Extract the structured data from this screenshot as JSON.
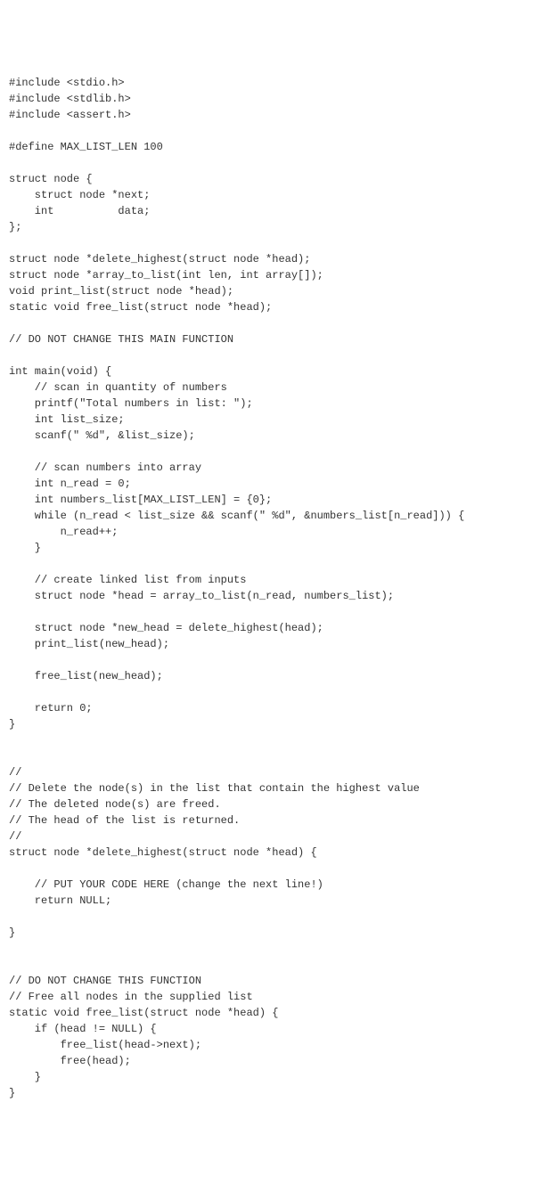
{
  "code": {
    "lines": [
      "#include <stdio.h>",
      "#include <stdlib.h>",
      "#include <assert.h>",
      "",
      "#define MAX_LIST_LEN 100",
      "",
      "struct node {",
      "    struct node *next;",
      "    int          data;",
      "};",
      "",
      "struct node *delete_highest(struct node *head);",
      "struct node *array_to_list(int len, int array[]);",
      "void print_list(struct node *head);",
      "static void free_list(struct node *head);",
      "",
      "// DO NOT CHANGE THIS MAIN FUNCTION",
      "",
      "int main(void) {",
      "    // scan in quantity of numbers",
      "    printf(\"Total numbers in list: \");",
      "    int list_size;",
      "    scanf(\" %d\", &list_size);",
      "",
      "    // scan numbers into array",
      "    int n_read = 0;",
      "    int numbers_list[MAX_LIST_LEN] = {0};",
      "    while (n_read < list_size && scanf(\" %d\", &numbers_list[n_read])) {",
      "        n_read++;",
      "    }",
      "",
      "    // create linked list from inputs",
      "    struct node *head = array_to_list(n_read, numbers_list);",
      "",
      "    struct node *new_head = delete_highest(head);",
      "    print_list(new_head);",
      "",
      "    free_list(new_head);",
      "",
      "    return 0;",
      "}",
      "",
      "",
      "//",
      "// Delete the node(s) in the list that contain the highest value",
      "// The deleted node(s) are freed.",
      "// The head of the list is returned.",
      "//",
      "struct node *delete_highest(struct node *head) {",
      "",
      "    // PUT YOUR CODE HERE (change the next line!)",
      "    return NULL;",
      "",
      "}",
      "",
      "",
      "// DO NOT CHANGE THIS FUNCTION",
      "// Free all nodes in the supplied list",
      "static void free_list(struct node *head) {",
      "    if (head != NULL) {",
      "        free_list(head->next);",
      "        free(head);",
      "    }",
      "}"
    ]
  }
}
